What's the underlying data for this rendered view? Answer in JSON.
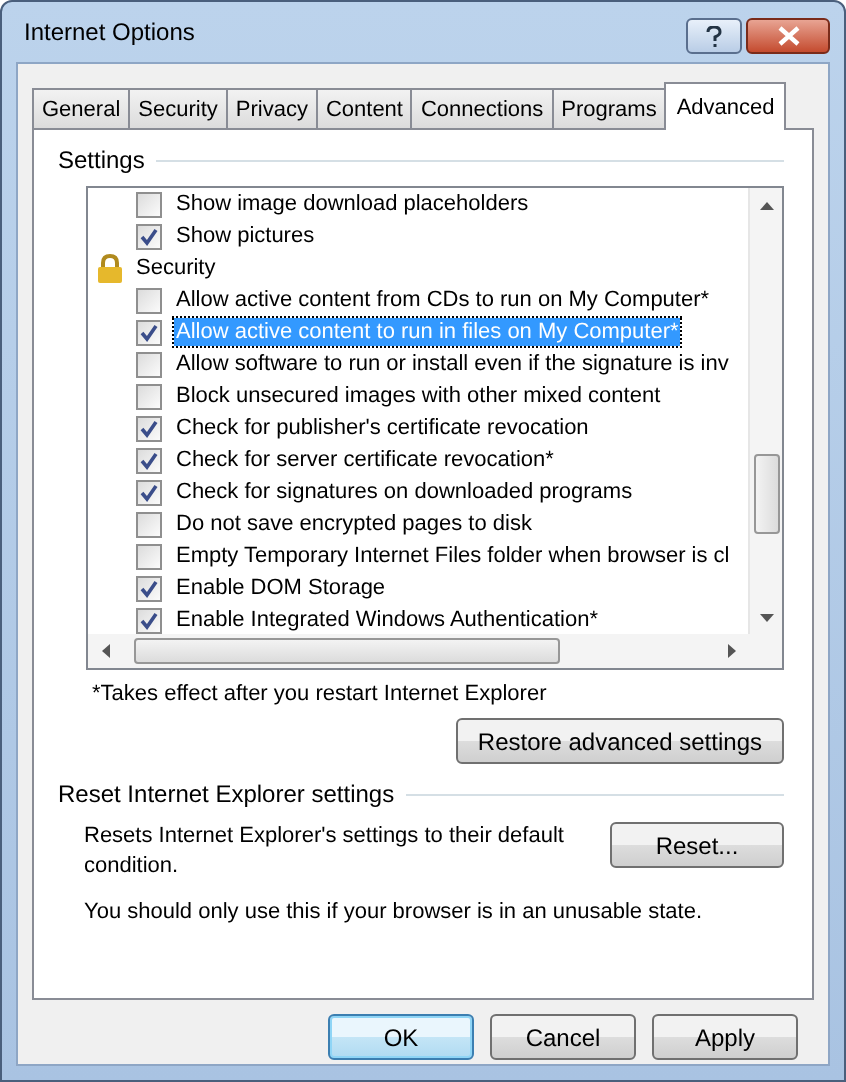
{
  "window": {
    "title": "Internet Options"
  },
  "tabs": [
    {
      "label": "General",
      "selected": false
    },
    {
      "label": "Security",
      "selected": false
    },
    {
      "label": "Privacy",
      "selected": false
    },
    {
      "label": "Content",
      "selected": false
    },
    {
      "label": "Connections",
      "selected": false
    },
    {
      "label": "Programs",
      "selected": false
    },
    {
      "label": "Advanced",
      "selected": true
    }
  ],
  "settings": {
    "heading": "Settings",
    "items": [
      {
        "kind": "checkbox",
        "label": "Show image download placeholders",
        "checked": false,
        "selected": false
      },
      {
        "kind": "checkbox",
        "label": "Show pictures",
        "checked": true,
        "selected": false
      },
      {
        "kind": "group",
        "label": "Security"
      },
      {
        "kind": "checkbox",
        "label": "Allow active content from CDs to run on My Computer*",
        "checked": false,
        "selected": false
      },
      {
        "kind": "checkbox",
        "label": "Allow active content to run in files on My Computer*",
        "checked": true,
        "selected": true
      },
      {
        "kind": "checkbox",
        "label": "Allow software to run or install even if the signature is inv",
        "checked": false,
        "selected": false
      },
      {
        "kind": "checkbox",
        "label": "Block unsecured images with other mixed content",
        "checked": false,
        "selected": false
      },
      {
        "kind": "checkbox",
        "label": "Check for publisher's certificate revocation",
        "checked": true,
        "selected": false
      },
      {
        "kind": "checkbox",
        "label": "Check for server certificate revocation*",
        "checked": true,
        "selected": false
      },
      {
        "kind": "checkbox",
        "label": "Check for signatures on downloaded programs",
        "checked": true,
        "selected": false
      },
      {
        "kind": "checkbox",
        "label": "Do not save encrypted pages to disk",
        "checked": false,
        "selected": false
      },
      {
        "kind": "checkbox",
        "label": "Empty Temporary Internet Files folder when browser is cl",
        "checked": false,
        "selected": false
      },
      {
        "kind": "checkbox",
        "label": "Enable DOM Storage",
        "checked": true,
        "selected": false
      },
      {
        "kind": "checkbox",
        "label": "Enable Integrated Windows Authentication*",
        "checked": true,
        "selected": false
      }
    ],
    "note": "*Takes effect after you restart Internet Explorer",
    "restore_button": "Restore advanced settings"
  },
  "reset": {
    "heading": "Reset Internet Explorer settings",
    "description": "Resets Internet Explorer's settings to their default condition.",
    "button": "Reset...",
    "warning": "You should only use this if your browser is in an unusable state."
  },
  "buttons": [
    {
      "label": "OK",
      "default": true
    },
    {
      "label": "Cancel",
      "default": false
    },
    {
      "label": "Apply",
      "default": false
    }
  ]
}
